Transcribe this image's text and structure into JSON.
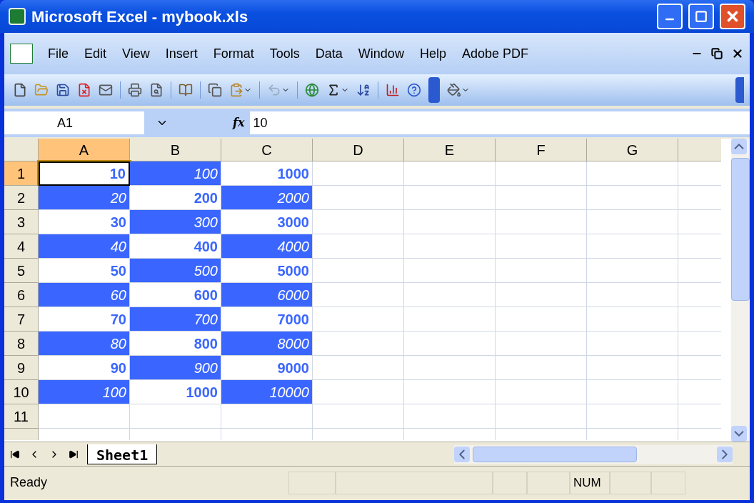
{
  "window": {
    "title": "Microsoft Excel - mybook.xls"
  },
  "menu": [
    "File",
    "Edit",
    "View",
    "Insert",
    "Format",
    "Tools",
    "Data",
    "Window",
    "Help",
    "Adobe PDF"
  ],
  "formula_bar": {
    "name_box": "A1",
    "function_label": "fx",
    "value": "10"
  },
  "columns": [
    {
      "label": "A",
      "selected": true
    },
    {
      "label": "B",
      "selected": false
    },
    {
      "label": "C",
      "selected": false
    },
    {
      "label": "D",
      "selected": false
    },
    {
      "label": "E",
      "selected": false
    },
    {
      "label": "F",
      "selected": false
    },
    {
      "label": "G",
      "selected": false
    }
  ],
  "rows": [
    {
      "header": "1",
      "selected": true,
      "cells": [
        {
          "text": "10",
          "shaded": false,
          "selected": true
        },
        {
          "text": "100",
          "shaded": true,
          "selected": false
        },
        {
          "text": "1000",
          "shaded": false,
          "selected": false
        }
      ]
    },
    {
      "header": "2",
      "selected": false,
      "cells": [
        {
          "text": "20",
          "shaded": true,
          "selected": false
        },
        {
          "text": "200",
          "shaded": false,
          "selected": false
        },
        {
          "text": "2000",
          "shaded": true,
          "selected": false
        }
      ]
    },
    {
      "header": "3",
      "selected": false,
      "cells": [
        {
          "text": "30",
          "shaded": false,
          "selected": false
        },
        {
          "text": "300",
          "shaded": true,
          "selected": false
        },
        {
          "text": "3000",
          "shaded": false,
          "selected": false
        }
      ]
    },
    {
      "header": "4",
      "selected": false,
      "cells": [
        {
          "text": "40",
          "shaded": true,
          "selected": false
        },
        {
          "text": "400",
          "shaded": false,
          "selected": false
        },
        {
          "text": "4000",
          "shaded": true,
          "selected": false
        }
      ]
    },
    {
      "header": "5",
      "selected": false,
      "cells": [
        {
          "text": "50",
          "shaded": false,
          "selected": false
        },
        {
          "text": "500",
          "shaded": true,
          "selected": false
        },
        {
          "text": "5000",
          "shaded": false,
          "selected": false
        }
      ]
    },
    {
      "header": "6",
      "selected": false,
      "cells": [
        {
          "text": "60",
          "shaded": true,
          "selected": false
        },
        {
          "text": "600",
          "shaded": false,
          "selected": false
        },
        {
          "text": "6000",
          "shaded": true,
          "selected": false
        }
      ]
    },
    {
      "header": "7",
      "selected": false,
      "cells": [
        {
          "text": "70",
          "shaded": false,
          "selected": false
        },
        {
          "text": "700",
          "shaded": true,
          "selected": false
        },
        {
          "text": "7000",
          "shaded": false,
          "selected": false
        }
      ]
    },
    {
      "header": "8",
      "selected": false,
      "cells": [
        {
          "text": "80",
          "shaded": true,
          "selected": false
        },
        {
          "text": "800",
          "shaded": false,
          "selected": false
        },
        {
          "text": "8000",
          "shaded": true,
          "selected": false
        }
      ]
    },
    {
      "header": "9",
      "selected": false,
      "cells": [
        {
          "text": "90",
          "shaded": false,
          "selected": false
        },
        {
          "text": "900",
          "shaded": true,
          "selected": false
        },
        {
          "text": "9000",
          "shaded": false,
          "selected": false
        }
      ]
    },
    {
      "header": "10",
      "selected": false,
      "cells": [
        {
          "text": "100",
          "shaded": true,
          "selected": false
        },
        {
          "text": "1000",
          "shaded": false,
          "selected": false
        },
        {
          "text": "10000",
          "shaded": true,
          "selected": false
        }
      ]
    },
    {
      "header": "11",
      "selected": false,
      "cells": []
    }
  ],
  "sheet_tabs": [
    {
      "label": "Sheet1",
      "selected": true
    }
  ],
  "status_bar": {
    "text": "Ready",
    "indicators": [
      "NUM"
    ]
  }
}
